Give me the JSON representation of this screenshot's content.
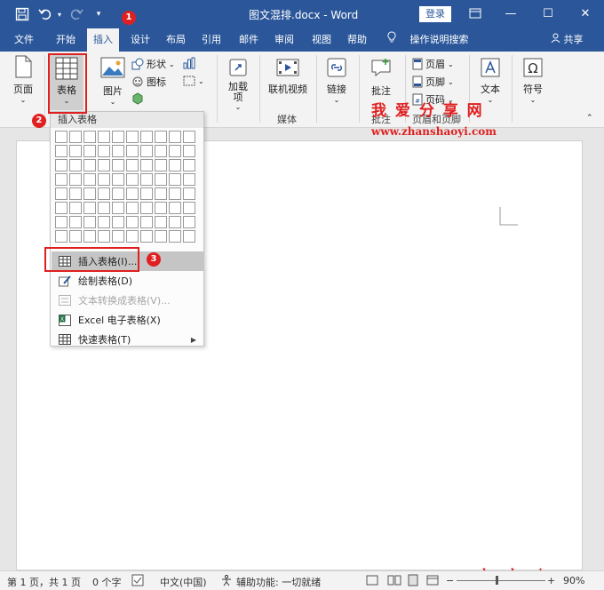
{
  "titlebar": {
    "save_icon": "save-icon",
    "undo_icon": "undo-icon",
    "redo_icon": "redo-icon",
    "doc_title": "图文混排.docx  -  Word",
    "login": "登录",
    "accent": "#2b579a"
  },
  "tabs": {
    "file": "文件",
    "home": "开始",
    "insert": "插入",
    "design": "设计",
    "layout": "布局",
    "references": "引用",
    "mailings": "邮件",
    "review": "审阅",
    "view": "视图",
    "help": "帮助",
    "tell_me": "操作说明搜索",
    "share": "共享"
  },
  "ribbon": {
    "pages": "页面",
    "table": "表格",
    "pictures": "图片",
    "shapes": "形状",
    "icons": "图标",
    "addins": "加载\n项",
    "online_video": "联机视频",
    "media_group": "媒体",
    "links": "链接",
    "comment": "批注",
    "comment_group": "批注",
    "header": "页眉",
    "footer": "页脚",
    "page_number": "页码",
    "header_footer_group": "页眉和页脚",
    "text": "文本",
    "symbols": "符号"
  },
  "dropdown": {
    "title": "插入表格",
    "items": [
      {
        "label": "插入表格(I)...",
        "icon": "table-icon"
      },
      {
        "label": "绘制表格(D)",
        "icon": "draw-table-icon"
      },
      {
        "label": "文本转换成表格(V)...",
        "icon": "convert-text-icon"
      },
      {
        "label": "Excel 电子表格(X)",
        "icon": "excel-icon"
      },
      {
        "label": "快速表格(T)",
        "icon": "quick-tables-icon"
      }
    ]
  },
  "annotations": {
    "step1": "1",
    "step2": "2",
    "step3": "3",
    "annotation_color": "#e02020"
  },
  "watermark": {
    "cn": "我 爱 分 享 网",
    "url_top": "www.zhanshaoyi.com",
    "url_bottom": "zhanshaoyi.com"
  },
  "status": {
    "page": "第 1 页，共 1 页",
    "words": "0 个字",
    "language": "中文(中国)",
    "accessibility": "辅助功能: 一切就绪",
    "zoom": "90%"
  }
}
